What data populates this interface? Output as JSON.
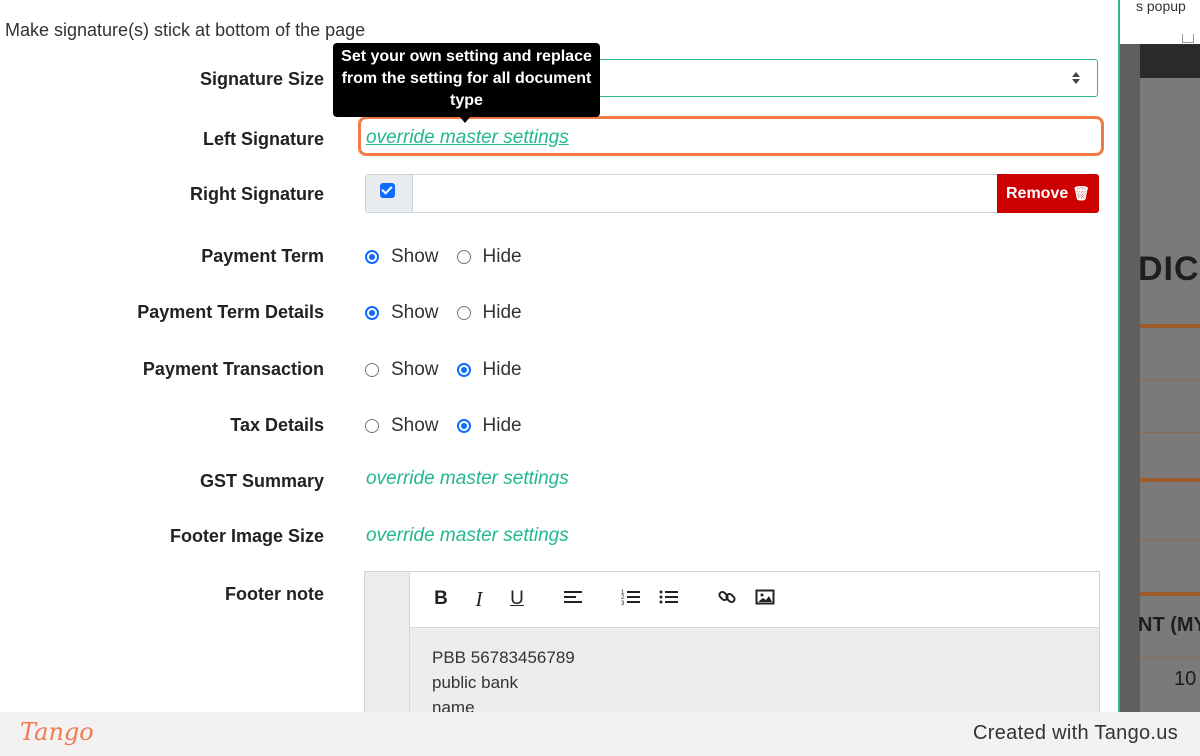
{
  "background": {
    "top_text": "s popup",
    "invoice_text": "DICE",
    "amount_text": "NT (MY",
    "row_value": "10"
  },
  "modal": {
    "top_note": "Make signature(s) stick at bottom of the page",
    "tooltip": "Set your own setting and replace from the setting for all document type",
    "override_text": "override master settings",
    "rows": {
      "signature_size": "Signature Size",
      "left_signature": "Left Signature",
      "right_signature": "Right Signature",
      "payment_term": "Payment Term",
      "payment_term_details": "Payment Term Details",
      "payment_transaction": "Payment Transaction",
      "tax_details": "Tax Details",
      "gst_summary": "GST Summary",
      "footer_image_size": "Footer Image Size",
      "footer_note": "Footer note"
    },
    "radio": {
      "show": "Show",
      "hide": "Hide"
    },
    "remove_button": "Remove",
    "right_signature_value": "",
    "editor": {
      "toolbar": [
        "bold-icon",
        "italic-icon",
        "underline-icon",
        "align-left-icon",
        "ordered-list-icon",
        "bullet-list-icon",
        "link-icon",
        "image-icon"
      ],
      "lines": [
        "PBB 56783456789",
        "public bank",
        "name"
      ]
    }
  },
  "footer": {
    "logo": "Tango",
    "created_with": "Created with Tango.us"
  },
  "colors": {
    "accent": "#22b88f",
    "highlight": "#f27a46",
    "danger": "#cc0000",
    "radio": "#0d6efd"
  }
}
